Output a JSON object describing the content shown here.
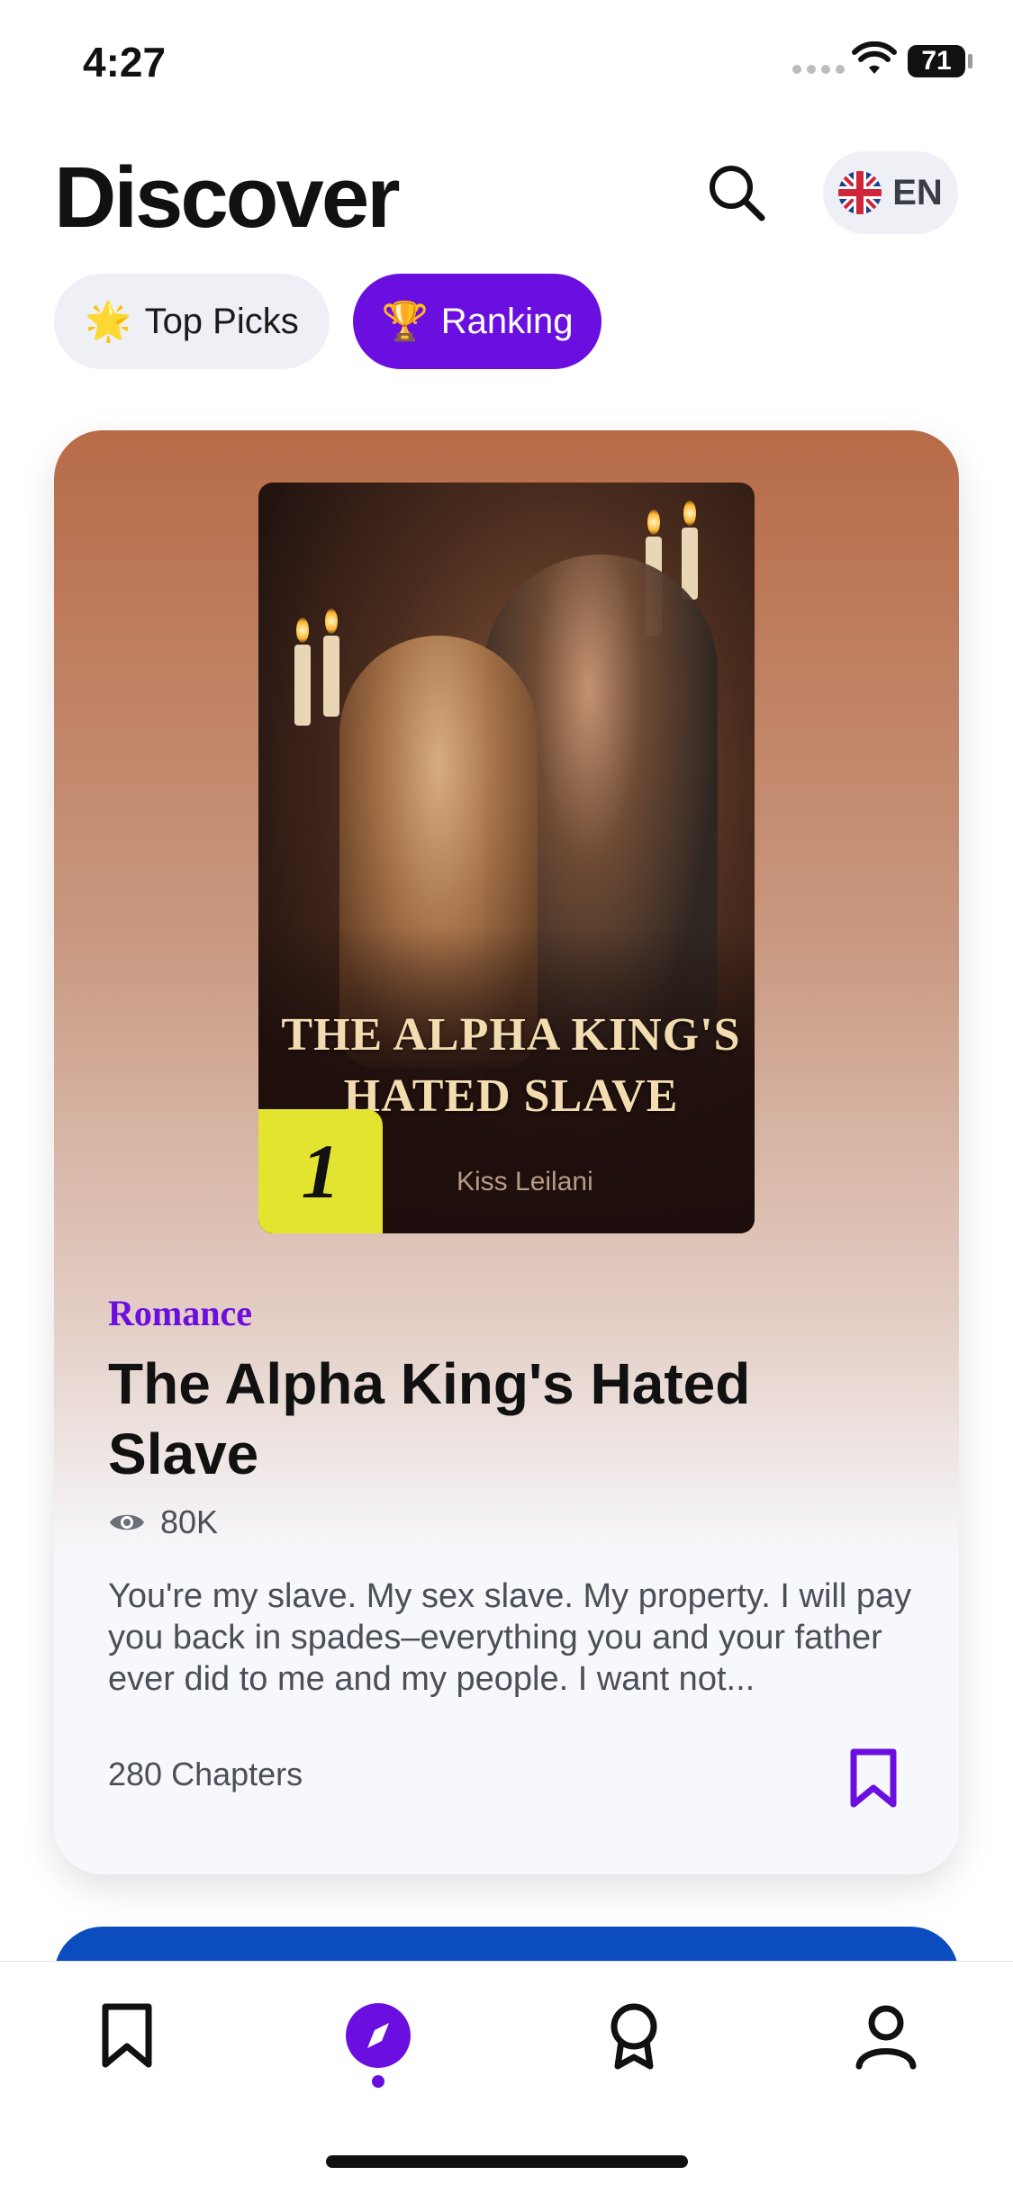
{
  "status_bar": {
    "time": "4:27",
    "battery": "71"
  },
  "header": {
    "title": "Discover",
    "language": "EN"
  },
  "tabs": [
    {
      "emoji": "🌟",
      "label": "Top Picks",
      "selected": false
    },
    {
      "emoji": "🏆",
      "label": "Ranking",
      "selected": true
    }
  ],
  "featured": {
    "rank": "1",
    "cover_title": "THE ALPHA KING'S HATED SLAVE",
    "cover_author": "Kiss Leilani",
    "genre": "Romance",
    "title": "The Alpha King's Hated Slave",
    "views": "80K",
    "description": "You're my slave. My sex slave. My property. I will pay you back in spades–everything you and your father ever did to me and my people. I want not...",
    "chapters": "280 Chapters"
  },
  "bottom_nav": [
    {
      "icon": "bookmark-icon",
      "active": false
    },
    {
      "icon": "compass-icon",
      "active": true
    },
    {
      "icon": "award-icon",
      "active": false
    },
    {
      "icon": "user-icon",
      "active": false
    }
  ],
  "colors": {
    "accent": "#6a0fe0",
    "rank_badge": "#e2e42f",
    "next_card": "#0b4cbf"
  }
}
